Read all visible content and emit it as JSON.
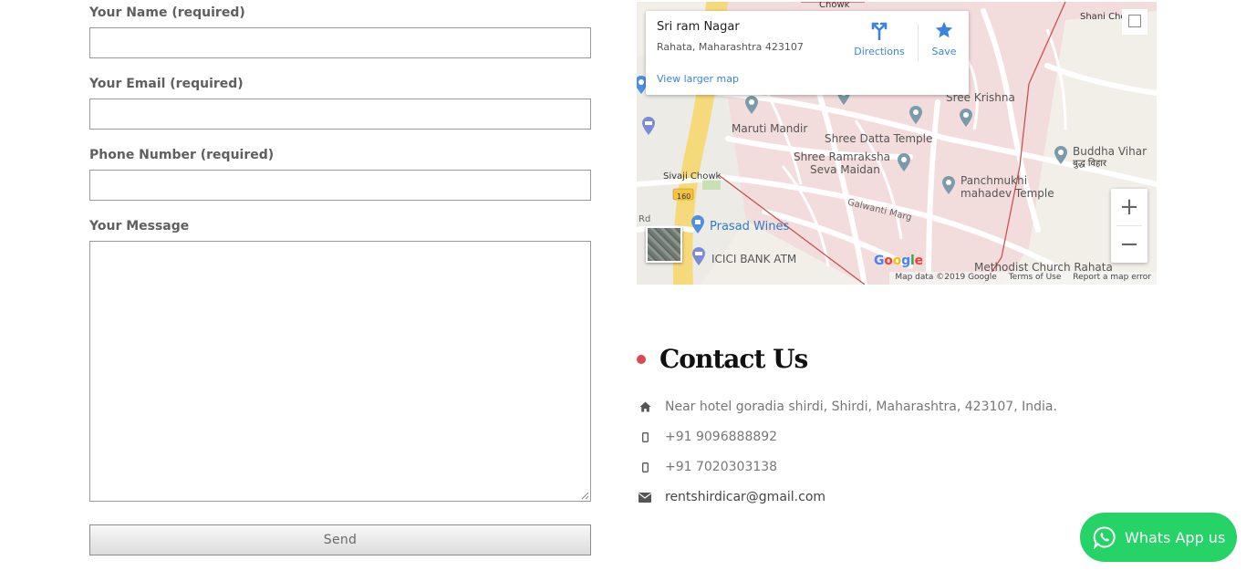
{
  "form": {
    "name_label": "Your Name (required)",
    "email_label": "Your Email (required)",
    "phone_label": "Phone Number (required)",
    "message_label": "Your Message",
    "send_label": "Send"
  },
  "map": {
    "info": {
      "title": "Sri ram Nagar",
      "address": "Rahata, Maharashtra 423107",
      "view_larger": "View larger map",
      "directions": "Directions",
      "save": "Save"
    },
    "labels": {
      "chowk": "Chowk",
      "shani": "Shani Cho",
      "sree_krishna": "Sree Krishna",
      "maruti": "Maruti Mandir",
      "datta": "Shree Datta Temple",
      "ramraksha": "Shree Ramraksha",
      "seva": "Seva Maidan",
      "buddha": "Buddha Vihar",
      "buddha_hi": "बुद्ध विहार",
      "sivaji": "Sivaji Chowk",
      "route": "160",
      "panchmukhi": "Panchmukhi",
      "mahadev": "mahadev Temple",
      "galwanti": "Galwanti Marg",
      "rd": "Rd",
      "prasad": "Prasad Wines",
      "icici": "ICICI BANK ATM",
      "methodist": "Methodist Church Rahata"
    },
    "attribution": {
      "data": "Map data ©2019 Google",
      "terms": "Terms of Use",
      "report": "Report a map error"
    },
    "google": [
      "G",
      "o",
      "o",
      "g",
      "l",
      "e"
    ],
    "google_colors": [
      "#4285f4",
      "#ea4335",
      "#fbbc05",
      "#4285f4",
      "#34a853",
      "#ea4335"
    ],
    "zoom_in": "+",
    "zoom_out": "−"
  },
  "contact": {
    "title": "Contact Us",
    "address": "Near hotel goradia shirdi, Shirdi, Maharashtra, 423107, India.",
    "phone1": "+91 9096888892",
    "phone2": "+91 7020303138",
    "email": "rentshirdicar@gmail.com",
    "accent_color": "#e0454d"
  },
  "whatsapp": {
    "label": "Whats App us",
    "color": "#25d366"
  }
}
